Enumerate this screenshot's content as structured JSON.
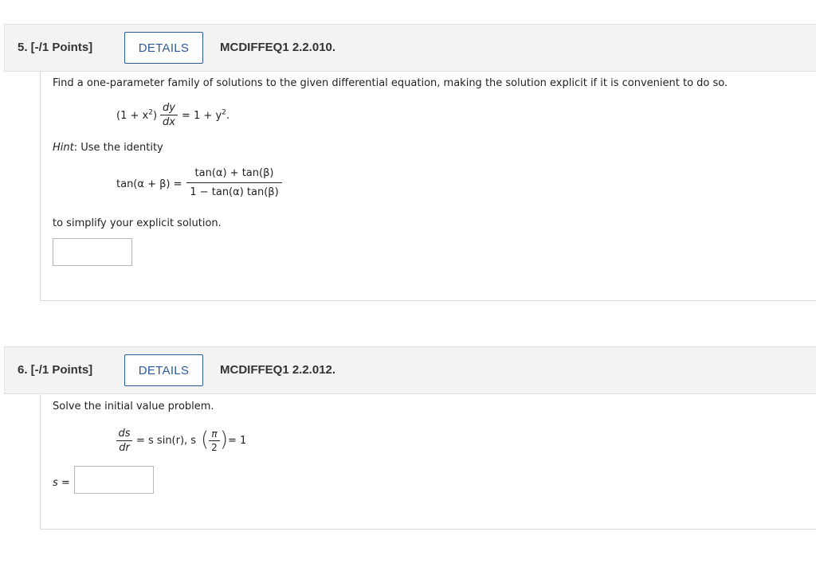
{
  "questions": [
    {
      "number": "5. [-/1 Points]",
      "details_label": "DETAILS",
      "code": "MCDIFFEQ1 2.2.010.",
      "prompt": "Find a one-parameter family of solutions to the given differential equation, making the solution explicit if it is convenient to do so.",
      "equation": {
        "left": "(1 + x",
        "exp": "2",
        "close": ")",
        "frac_num": "dy",
        "frac_den": "dx",
        "right": "= 1 + y",
        "right_exp": "2",
        "right_end": "."
      },
      "hint_label": "Hint",
      "hint_text": ": Use the identity",
      "identity": {
        "lhs": "tan(α + β) =",
        "num": "tan(α) + tan(β)",
        "den": "1 − tan(α) tan(β)"
      },
      "after_text": "to simplify your explicit solution.",
      "answer_value": ""
    },
    {
      "number": "6. [-/1 Points]",
      "details_label": "DETAILS",
      "code": "MCDIFFEQ1 2.2.012.",
      "prompt": "Solve the initial value problem.",
      "equation": {
        "frac_num": "ds",
        "frac_den": "dr",
        "mid": "= s sin(r), s",
        "ic_num": "π",
        "ic_den": "2",
        "end": "= 1"
      },
      "answer_label": "s =",
      "answer_value": ""
    }
  ]
}
